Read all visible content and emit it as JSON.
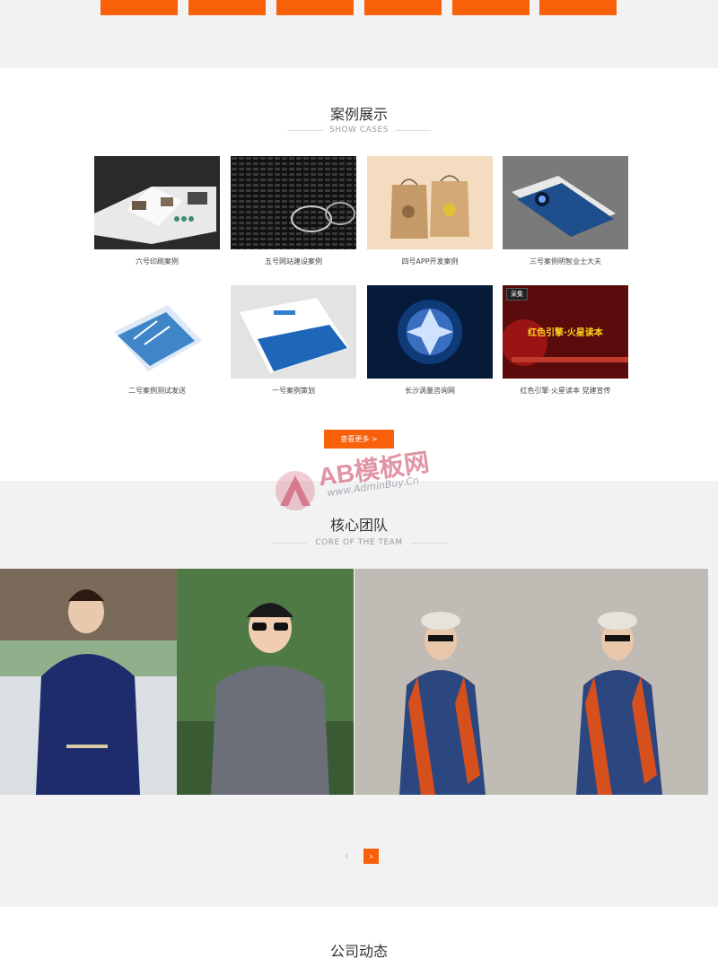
{
  "top_buttons": [
    "",
    "",
    "",
    "",
    "",
    ""
  ],
  "cases": {
    "title": "案例展示",
    "subtitle": "SHOW CASES",
    "items": [
      {
        "label": "六号印刷案例"
      },
      {
        "label": "五号网站建设案例"
      },
      {
        "label": "四号APP开发案例"
      },
      {
        "label": "三号案例明智业士大夫"
      },
      {
        "label": "二号案例测试发送"
      },
      {
        "label": "一号案例策划"
      },
      {
        "label": "长沙涡量咨询网"
      },
      {
        "label": "红色引擎·火星读本 党建宣传",
        "badge": "采集",
        "banner": "红色引擎·火星读本"
      }
    ],
    "more_label": "查看更多 >"
  },
  "watermark": {
    "text": "AB模板网",
    "url": "www.AdminBuy.Cn"
  },
  "team": {
    "title": "核心团队",
    "subtitle": "CORE OF THE TEAM",
    "prev_icon": "‹",
    "next_icon": "›"
  },
  "news": {
    "title": "公司动态"
  },
  "colors": {
    "accent": "#f8600a",
    "section_gray": "#f2f2f2"
  }
}
